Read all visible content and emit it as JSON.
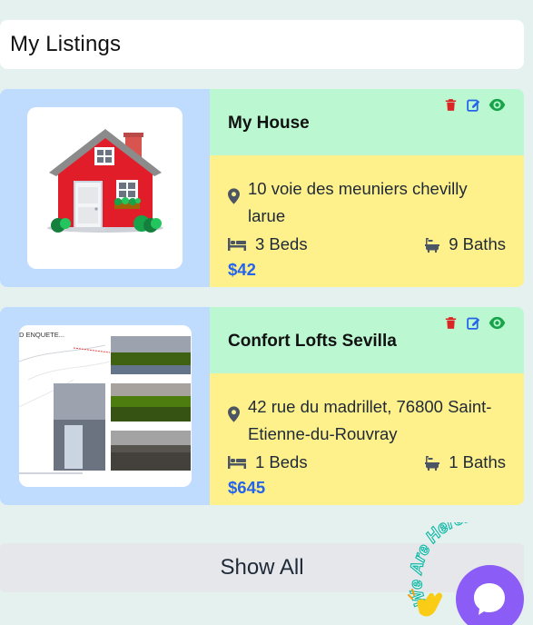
{
  "page": {
    "title": "My Listings"
  },
  "listings": [
    {
      "title": "My House",
      "address": "10 voie des meuniers chevilly larue",
      "beds": "3 Beds",
      "baths": "9 Baths",
      "price": "$42"
    },
    {
      "title": "Confort Lofts Sevilla",
      "address": "42 rue du madrillet, 76800 Saint-Etienne-du-Rouvray",
      "beds": "1 Beds",
      "baths": "1 Baths",
      "price": "$645",
      "image_text": "D ENQUETE..."
    }
  ],
  "footer": {
    "show_all_label": "Show All"
  },
  "chat_widget": {
    "label": "We Are Here!"
  },
  "colors": {
    "background": "#e4f1ee",
    "card_left": "#bfdbfe",
    "card_top": "#bbf7d0",
    "card_bottom": "#fef08a",
    "price": "#2563eb",
    "delete": "#dc2626",
    "edit": "#2563eb",
    "view": "#16a34a",
    "chat": "#8b5cf6"
  },
  "icons": [
    "trash-icon",
    "edit-icon",
    "eye-icon",
    "map-pin-icon",
    "bed-icon",
    "bath-icon",
    "chat-icon",
    "waving-hand-icon"
  ]
}
